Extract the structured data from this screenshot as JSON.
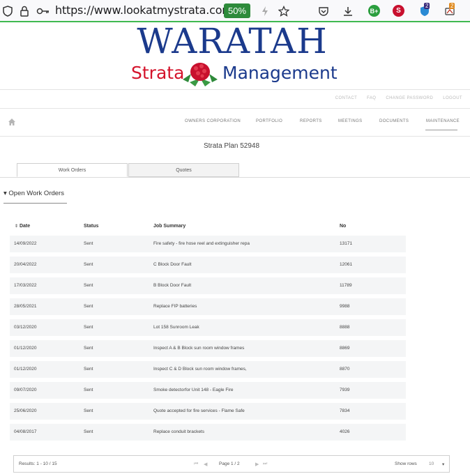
{
  "browser": {
    "url": "https://www.lookatmystrata.com",
    "zoom": "50%",
    "ext_b_label": "B+",
    "ext_s_label": "S",
    "badge_1": "2",
    "badge_2": "2"
  },
  "logo": {
    "top_text": "WARATAH",
    "left_text": "Strata",
    "right_text": "Management"
  },
  "top_links": [
    "CONTACT",
    "FAQ",
    "CHANGE PASSWORD",
    "LOGOUT"
  ],
  "main_nav": [
    "OWNERS CORPORATION",
    "PORTFOLIO",
    "REPORTS",
    "MEETINGS",
    "DOCUMENTS",
    "MAINTENANCE"
  ],
  "plan_title": "Strata Plan 52948",
  "tabs": [
    "Work Orders",
    "Quotes"
  ],
  "section": {
    "caret": "▾",
    "title": "Open Work Orders"
  },
  "table": {
    "sort_indicator": "⇕",
    "headers": [
      "Date",
      "Status",
      "Job Summary",
      "No"
    ],
    "rows": [
      [
        "14/09/2022",
        "Sent",
        "Fire safety - fire hose reel and extinguisher repa",
        "13171"
      ],
      [
        "20/04/2022",
        "Sent",
        "C Block Door Fault",
        "12061"
      ],
      [
        "17/03/2022",
        "Sent",
        "B Block Door Fault",
        "11789"
      ],
      [
        "28/05/2021",
        "Sent",
        "Replace FIP batteries",
        "9988"
      ],
      [
        "03/12/2020",
        "Sent",
        "Lot 158 Sunroom Leak",
        "8888"
      ],
      [
        "01/12/2020",
        "Sent",
        "Inspect A & B Block sun room window frames",
        "8869"
      ],
      [
        "01/12/2020",
        "Sent",
        "Inspect C & D Block sun room window frames,",
        "8870"
      ],
      [
        "09/07/2020",
        "Sent",
        "Smoke detectorfor Unit 148 - Eagle Fire",
        "7939"
      ],
      [
        "25/06/2020",
        "Sent",
        "Quote accepted for fire services - Flame Safe",
        "7834"
      ],
      [
        "04/08/2017",
        "Sent",
        "Replace conduit brackets",
        "4026"
      ]
    ]
  },
  "pager": {
    "results": "Results: 1 - 10 / 15",
    "page": "Page 1 / 2",
    "show_rows_label": "Show rows",
    "rows_value": "10",
    "first": "⏮",
    "prev": "◀",
    "next": "▶",
    "last": "⏭",
    "dropdown": "▾"
  }
}
